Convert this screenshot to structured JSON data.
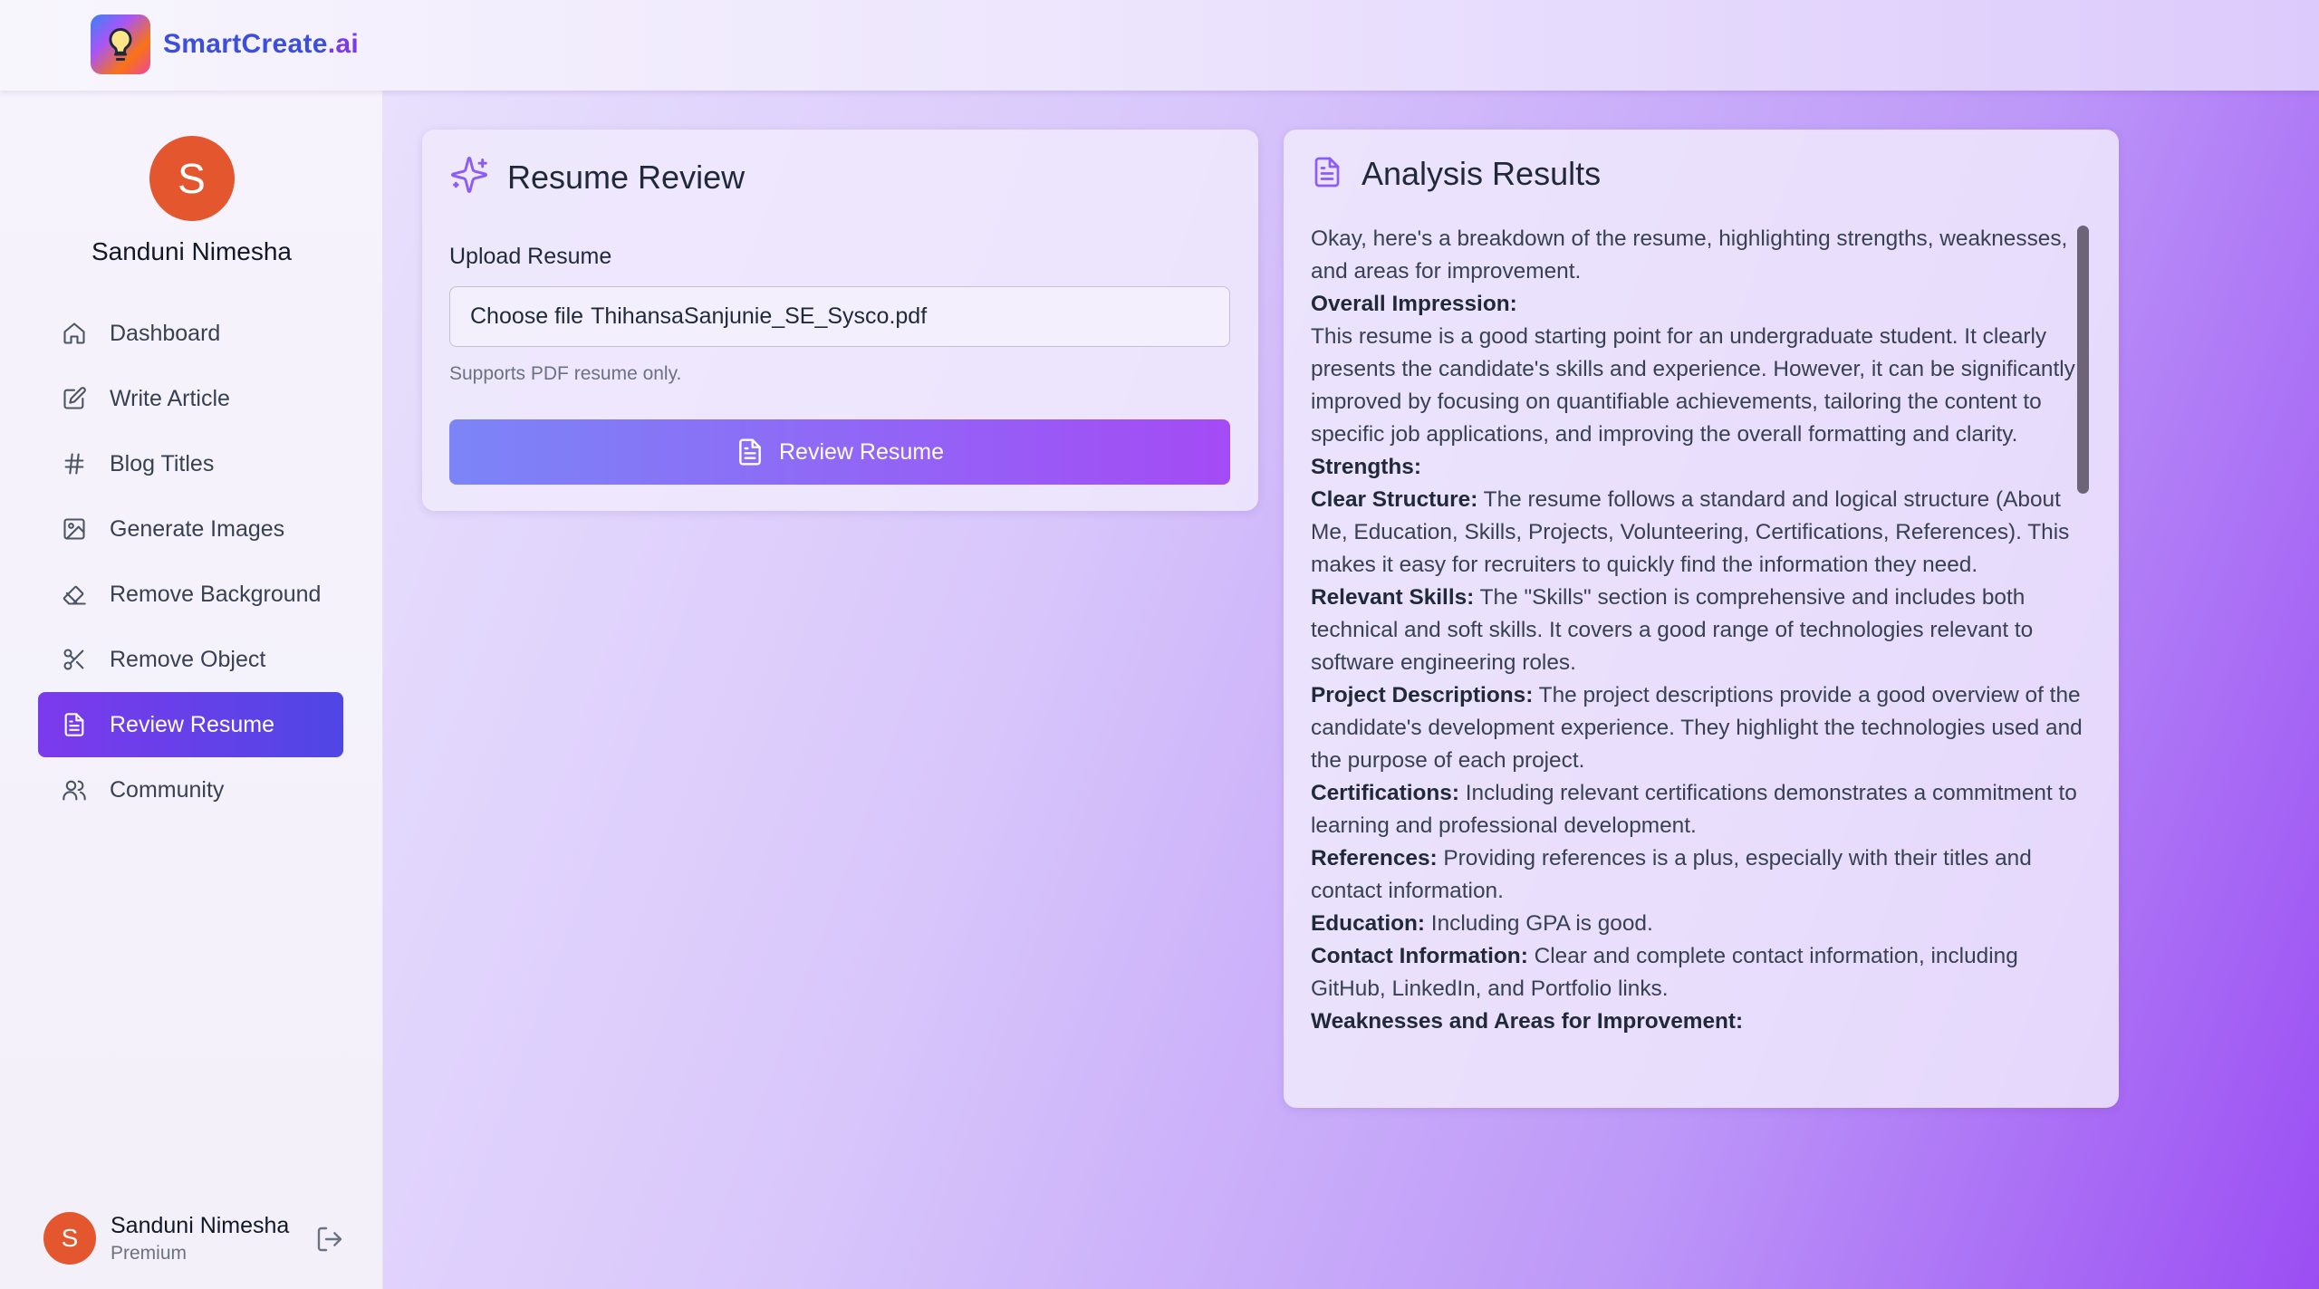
{
  "app": {
    "name_main": "SmartCreate",
    "name_suffix": ".ai"
  },
  "sidebar": {
    "profile": {
      "initial": "S",
      "name": "Sanduni Nimesha"
    },
    "items": [
      {
        "label": "Dashboard",
        "icon": "home-icon"
      },
      {
        "label": "Write Article",
        "icon": "edit-icon"
      },
      {
        "label": "Blog Titles",
        "icon": "hash-icon"
      },
      {
        "label": "Generate Images",
        "icon": "image-icon"
      },
      {
        "label": "Remove Background",
        "icon": "eraser-icon"
      },
      {
        "label": "Remove Object",
        "icon": "scissors-icon"
      },
      {
        "label": "Review Resume",
        "icon": "file-text-icon",
        "active": true
      },
      {
        "label": "Community",
        "icon": "users-icon"
      }
    ],
    "footer": {
      "initial": "S",
      "name": "Sanduni Nimesha",
      "plan": "Premium"
    }
  },
  "review_card": {
    "title": "Resume Review",
    "upload_label": "Upload Resume",
    "choose_label": "Choose file",
    "file_name": "ThihansaSanjunie_SE_Sysco.pdf",
    "hint": "Supports PDF resume only.",
    "button_label": "Review Resume"
  },
  "results_card": {
    "title": "Analysis Results",
    "intro": "Okay, here's a breakdown of the resume, highlighting strengths, weaknesses, and areas for improvement.",
    "overall_heading": "Overall Impression:",
    "overall_text": "This resume is a good starting point for an undergraduate student. It clearly presents the candidate's skills and experience. However, it can be significantly improved by focusing on quantifiable achievements, tailoring the content to specific job applications, and improving the overall formatting and clarity.",
    "strengths_heading": "Strengths:",
    "strengths": [
      {
        "label": "Clear Structure:",
        "text": " The resume follows a standard and logical structure (About Me, Education, Skills, Projects, Volunteering, Certifications, References). This makes it easy for recruiters to quickly find the information they need."
      },
      {
        "label": "Relevant Skills:",
        "text": " The \"Skills\" section is comprehensive and includes both technical and soft skills. It covers a good range of technologies relevant to software engineering roles."
      },
      {
        "label": "Project Descriptions:",
        "text": " The project descriptions provide a good overview of the candidate's development experience. They highlight the technologies used and the purpose of each project."
      },
      {
        "label": "Certifications:",
        "text": " Including relevant certifications demonstrates a commitment to learning and professional development."
      },
      {
        "label": "References:",
        "text": " Providing references is a plus, especially with their titles and contact information."
      },
      {
        "label": "Education:",
        "text": " Including GPA is good."
      },
      {
        "label": "Contact Information:",
        "text": " Clear and complete contact information, including GitHub, LinkedIn, and Portfolio links."
      }
    ],
    "weaknesses_heading": "Weaknesses and Areas for Improvement:"
  },
  "colors": {
    "accent": "#7c3aed",
    "avatar": "#e4572e",
    "button_start": "#7b85f7",
    "button_end": "#a44bf5"
  }
}
